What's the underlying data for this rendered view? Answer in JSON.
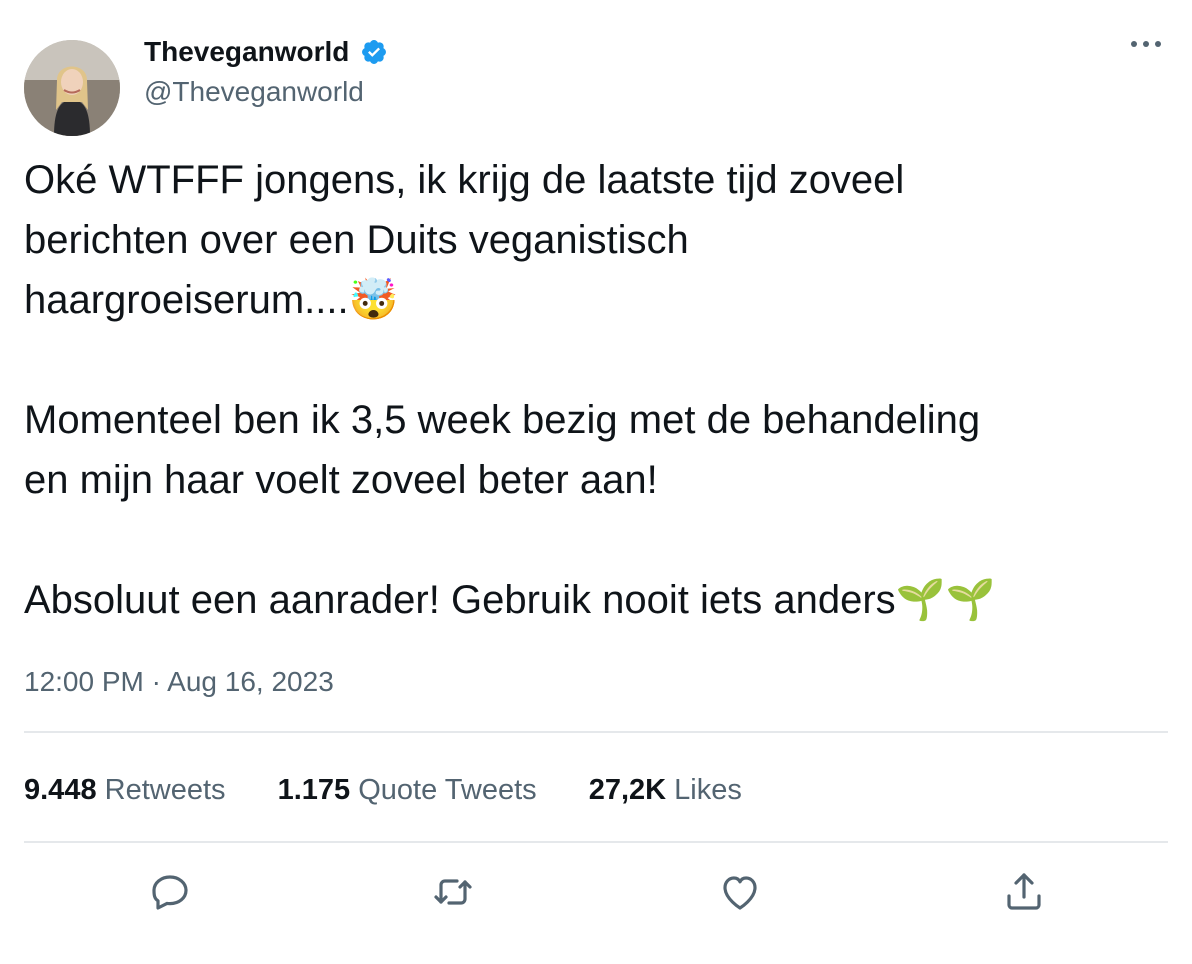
{
  "author": {
    "display_name": "Theveganworld",
    "handle": "@Theveganworld",
    "verified": true,
    "badge_color": "#1d9bf0"
  },
  "tweet": {
    "text": "Oké WTFFF jongens, ik krijg de laatste tijd zoveel\nberichten over een Duits veganistisch\nhaargroeiserum....🤯\n\nMomenteel ben ik 3,5 week bezig met de behandeling\nen mijn haar voelt zoveel beter aan!\n\nAbsoluut een aanrader! Gebruik nooit iets anders🌱🌱",
    "timestamp": "12:00 PM · Aug 16, 2023"
  },
  "stats": {
    "retweets": {
      "count": "9.448",
      "label": "Retweets"
    },
    "quotes": {
      "count": "1.175",
      "label": "Quote Tweets"
    },
    "likes": {
      "count": "27,2K",
      "label": "Likes"
    }
  },
  "actions": [
    {
      "icon": "reply-icon"
    },
    {
      "icon": "retweet-icon"
    },
    {
      "icon": "like-icon"
    },
    {
      "icon": "share-icon"
    }
  ],
  "colors": {
    "text": "#0f1419",
    "secondary": "#536471",
    "divider": "#e5e8eb",
    "accent": "#1d9bf0"
  }
}
